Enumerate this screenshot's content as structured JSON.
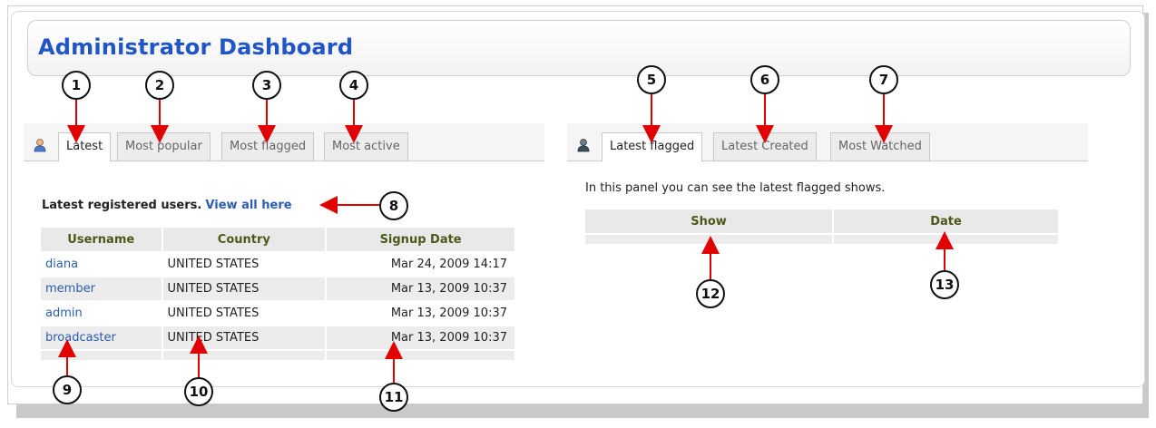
{
  "header": {
    "title": "Administrator Dashboard"
  },
  "left_panel": {
    "icon": "users-icon",
    "tabs": [
      {
        "label": "Latest",
        "active": true
      },
      {
        "label": "Most popular",
        "active": false
      },
      {
        "label": "Most flagged",
        "active": false
      },
      {
        "label": "Most active",
        "active": false
      }
    ],
    "caption_text": "Latest registered users.",
    "caption_link": "View all here",
    "table": {
      "headers": [
        "Username",
        "Country",
        "Signup Date"
      ],
      "rows": [
        [
          "diana",
          "UNITED STATES",
          "Mar 24, 2009 14:17"
        ],
        [
          "member",
          "UNITED STATES",
          "Mar 13, 2009 10:37"
        ],
        [
          "admin",
          "UNITED STATES",
          "Mar 13, 2009 10:37"
        ],
        [
          "broadcaster",
          "UNITED STATES",
          "Mar 13, 2009 10:37"
        ]
      ]
    }
  },
  "right_panel": {
    "icon": "flagged-user-icon",
    "tabs": [
      {
        "label": "Latest flagged",
        "active": true
      },
      {
        "label": "Latest Created",
        "active": false
      },
      {
        "label": "Most Watched",
        "active": false
      }
    ],
    "description": "In this panel you can see the latest flagged shows.",
    "table": {
      "headers": [
        "Show",
        "Date"
      ]
    }
  },
  "callouts": [
    "1",
    "2",
    "3",
    "4",
    "5",
    "6",
    "7",
    "8",
    "9",
    "10",
    "11",
    "12",
    "13"
  ],
  "colors": {
    "title": "#1f55c9",
    "arrow": "#e00000",
    "link": "#2a5db0",
    "header_text": "#4b5a1a"
  }
}
